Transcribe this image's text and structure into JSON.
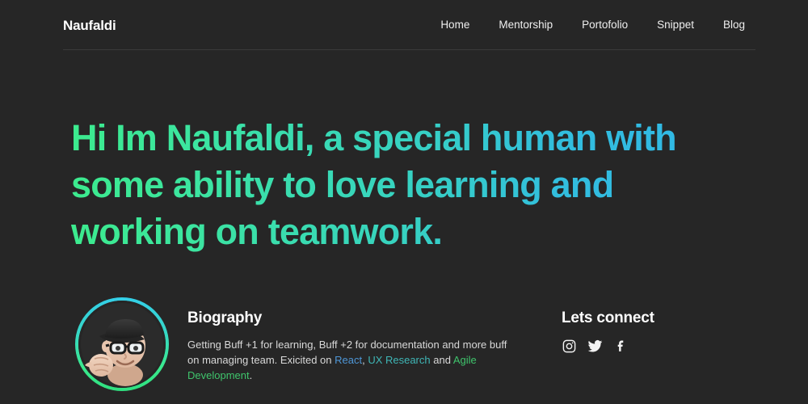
{
  "site": {
    "background_color": "#262626",
    "brand": "Naufaldi"
  },
  "header": {
    "brand_label": "Naufaldi",
    "nav": [
      {
        "label": "Home"
      },
      {
        "label": "Mentorship"
      },
      {
        "label": "Portofolio"
      },
      {
        "label": "Snippet"
      },
      {
        "label": "Blog"
      }
    ]
  },
  "hero": {
    "headline": "Hi Im Naufaldi, a special human with some ability to love learning and working on teamwork.",
    "gradient_start": "#3ceb8e",
    "gradient_end": "#30b6e8"
  },
  "biography": {
    "title": "Biography",
    "text_part_1": "Getting Buff +1 for learning, Buff +2 for documentation and more buff on managing team. Exicited on ",
    "link_react": "React",
    "text_part_2": ", ",
    "link_ux_research": "UX Research",
    "text_part_3": " and ",
    "link_agile": "Agile Development",
    "text_part_4": ".",
    "link_colors": {
      "react": "#4e96d6",
      "ux_research": "#3fb6b6",
      "agile_development": "#3fc46c"
    }
  },
  "avatar": {
    "alt": "memoji-avatar",
    "ring_gradient_top": "#34cfe8",
    "ring_gradient_bottom": "#2fe07f"
  },
  "connect": {
    "title": "Lets connect",
    "socials": [
      {
        "name": "instagram-icon",
        "label": "Instagram"
      },
      {
        "name": "twitter-icon",
        "label": "Twitter"
      },
      {
        "name": "facebook-icon",
        "label": "Facebook"
      }
    ]
  }
}
